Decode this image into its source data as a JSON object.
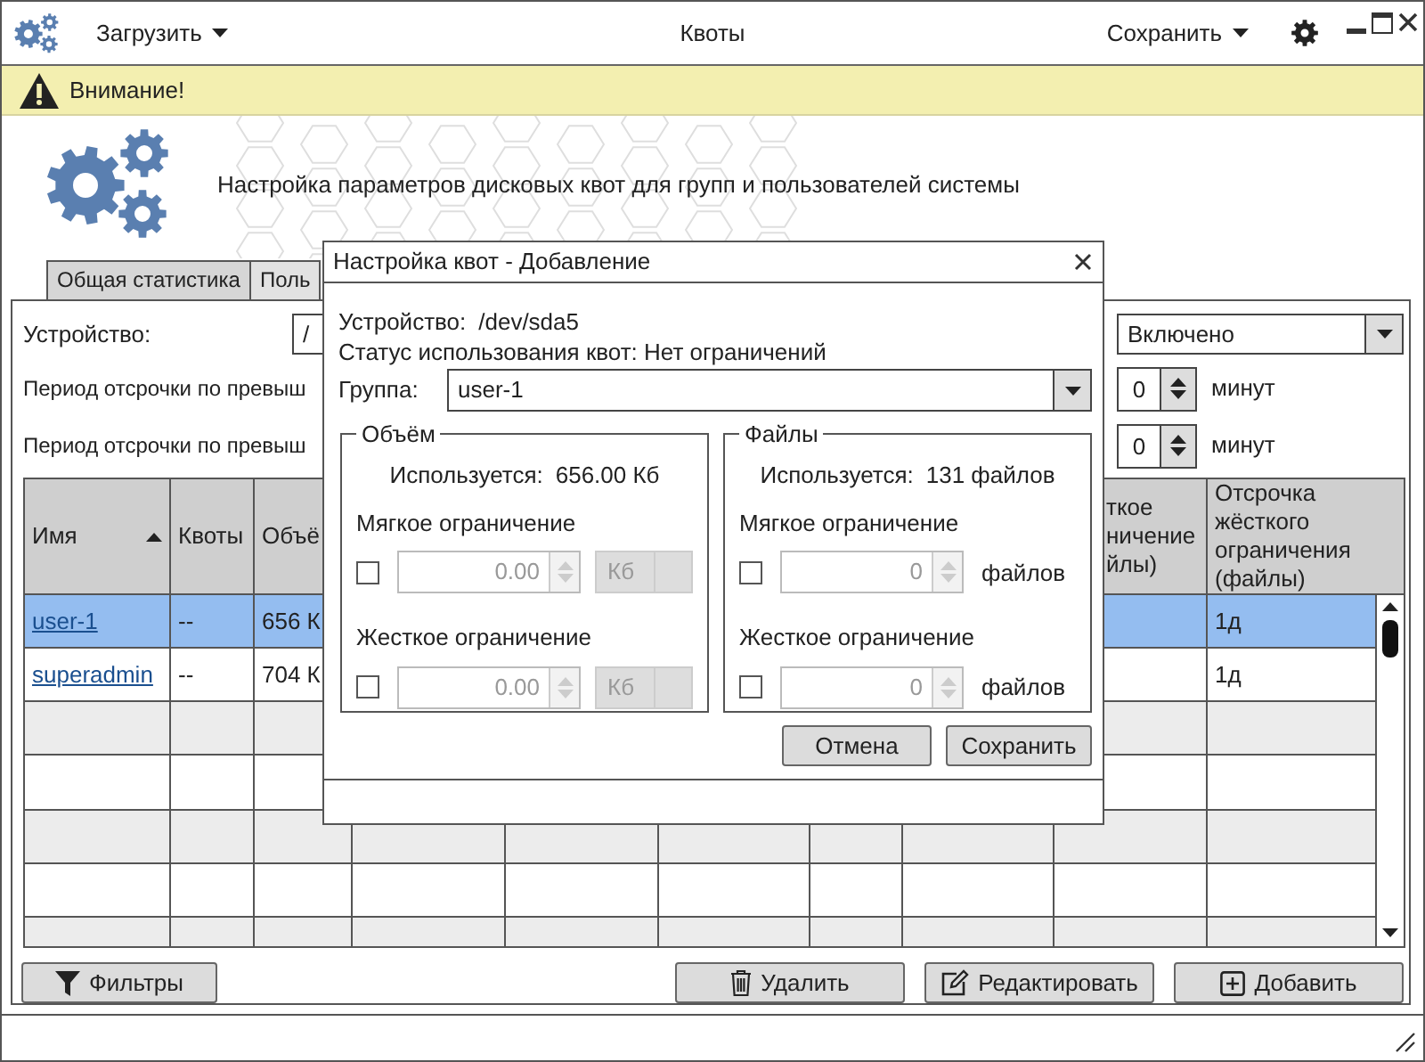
{
  "app": {
    "title": "Квоты",
    "load_menu": {
      "label": "Загрузить"
    },
    "save_menu": {
      "label": "Сохранить"
    }
  },
  "warning": {
    "text": "Внимание!"
  },
  "header": {
    "text": "Настройка параметров дисковых квот для групп и пользователей системы"
  },
  "tabs": [
    {
      "label": "Общая статистика",
      "selected": false
    },
    {
      "label": "Поль",
      "selected": true
    }
  ],
  "settings": {
    "device": {
      "label": "Устройство:",
      "value": "/"
    },
    "mode": {
      "value": "Включено"
    },
    "grace_periods": [
      {
        "label": "Период отсрочки по превыш",
        "value": "0",
        "unit": "минут"
      },
      {
        "label": "Период отсрочки по превыш",
        "value": "0",
        "unit": "минут"
      }
    ]
  },
  "table": {
    "columns": [
      {
        "label": "Имя",
        "sort_ascending": true
      },
      {
        "label": "Квоты"
      },
      {
        "label": "Объё"
      },
      {
        "label": "ткое\nничение\nйлы)"
      },
      {
        "label": "Отсрочка жёсткого ограничения (файлы)"
      }
    ],
    "rows": [
      {
        "name": "user-1",
        "quotas": "--",
        "volume": "656 К",
        "hard_grace_files": "1д",
        "selected": true
      },
      {
        "name": "superadmin",
        "quotas": "--",
        "volume": "704 К",
        "hard_grace_files": "1д",
        "selected": false
      }
    ]
  },
  "actions": [
    {
      "label": "Фильтры",
      "kind": "filter"
    },
    {
      "label": "Удалить",
      "kind": "delete"
    },
    {
      "label": "Редактировать",
      "kind": "edit"
    },
    {
      "label": "Добавить",
      "kind": "add"
    }
  ],
  "dialog": {
    "title": "Настройка квот - Добавление",
    "device_label": "Устройство:",
    "device": "/dev/sda5",
    "status": "Статус использования квот: Нет ограничений",
    "group": {
      "label": "Группа:",
      "value": "user-1"
    },
    "sections": [
      {
        "title": "Объём",
        "used_label": "Используется:",
        "used": "656.00 Кб",
        "limits": [
          {
            "label": "Мягкое ограничение",
            "checked": false,
            "disabled": true,
            "value": "0.00",
            "unit": "Кб",
            "kind": "select"
          },
          {
            "label": "Жесткое ограничение",
            "checked": false,
            "disabled": true,
            "value": "0.00",
            "unit": "Кб",
            "kind": "select"
          }
        ]
      },
      {
        "title": "Файлы",
        "used_label": "Используется:",
        "used": "131 файлов",
        "limits": [
          {
            "label": "Мягкое ограничение",
            "checked": false,
            "disabled": true,
            "value": "0",
            "unit": "файлов",
            "kind": "text"
          },
          {
            "label": "Жесткое ограничение",
            "checked": false,
            "disabled": true,
            "value": "0",
            "unit": "файлов",
            "kind": "text"
          }
        ]
      }
    ],
    "buttons": [
      "Отмена",
      "Сохранить"
    ]
  }
}
